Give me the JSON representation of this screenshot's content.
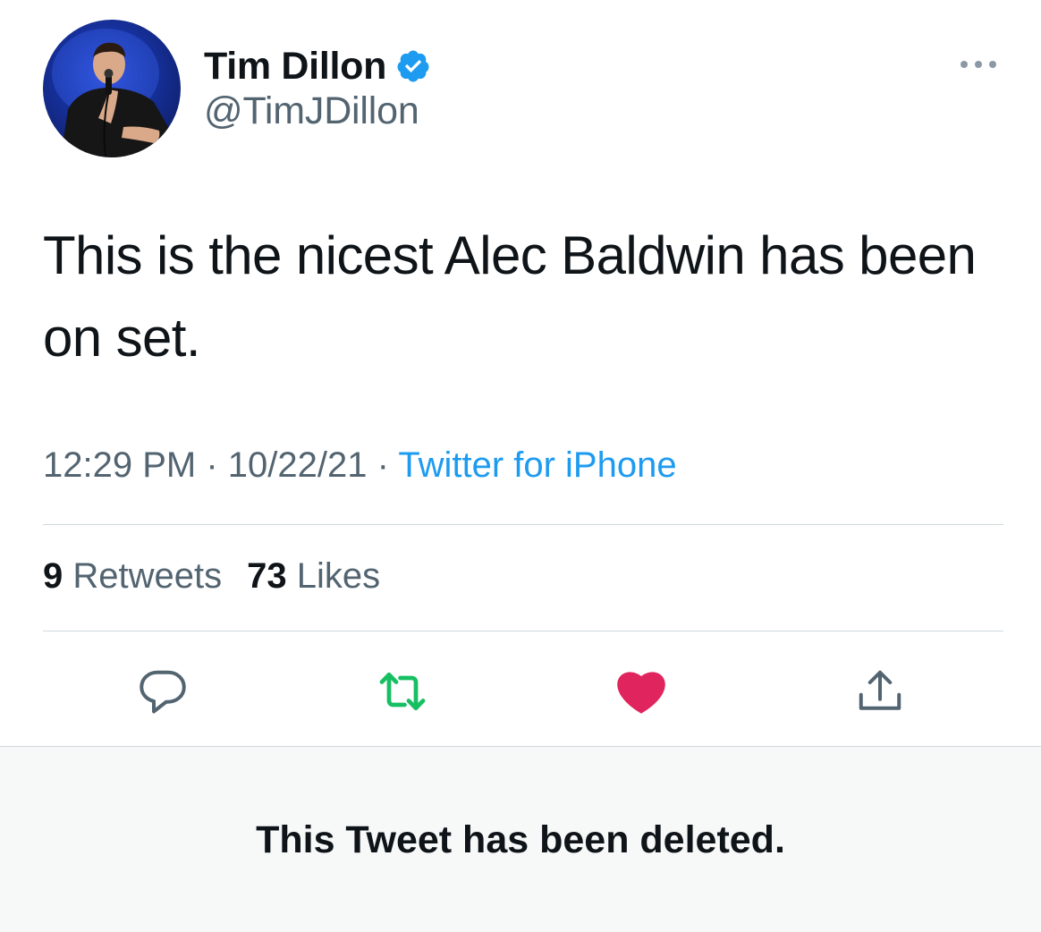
{
  "tweet": {
    "author": {
      "display_name": "Tim Dillon",
      "handle": "@TimJDillon",
      "verified": true
    },
    "text": "This is the nicest Alec Baldwin has been on set.",
    "time": "12:29 PM",
    "date": "10/22/21",
    "source": "Twitter for iPhone",
    "separator": "·",
    "stats": {
      "retweets_count": "9",
      "retweets_label": "Retweets",
      "likes_count": "73",
      "likes_label": "Likes"
    },
    "actions": [
      {
        "name": "reply-icon"
      },
      {
        "name": "retweet-icon",
        "color": "#17bf63"
      },
      {
        "name": "heart-icon",
        "color": "#e0245e"
      },
      {
        "name": "share-icon"
      }
    ],
    "more_icon": "more-icon"
  },
  "quoted": {
    "deleted_notice": "This Tweet has been deleted."
  },
  "colors": {
    "text_primary": "#0f1419",
    "text_secondary": "#536471",
    "link": "#1d9bf0",
    "verified": "#1d9bf0",
    "retweet": "#17bf63",
    "like": "#e0245e",
    "divider": "#cfd9de",
    "deleted_bg": "#f7f9f9"
  }
}
